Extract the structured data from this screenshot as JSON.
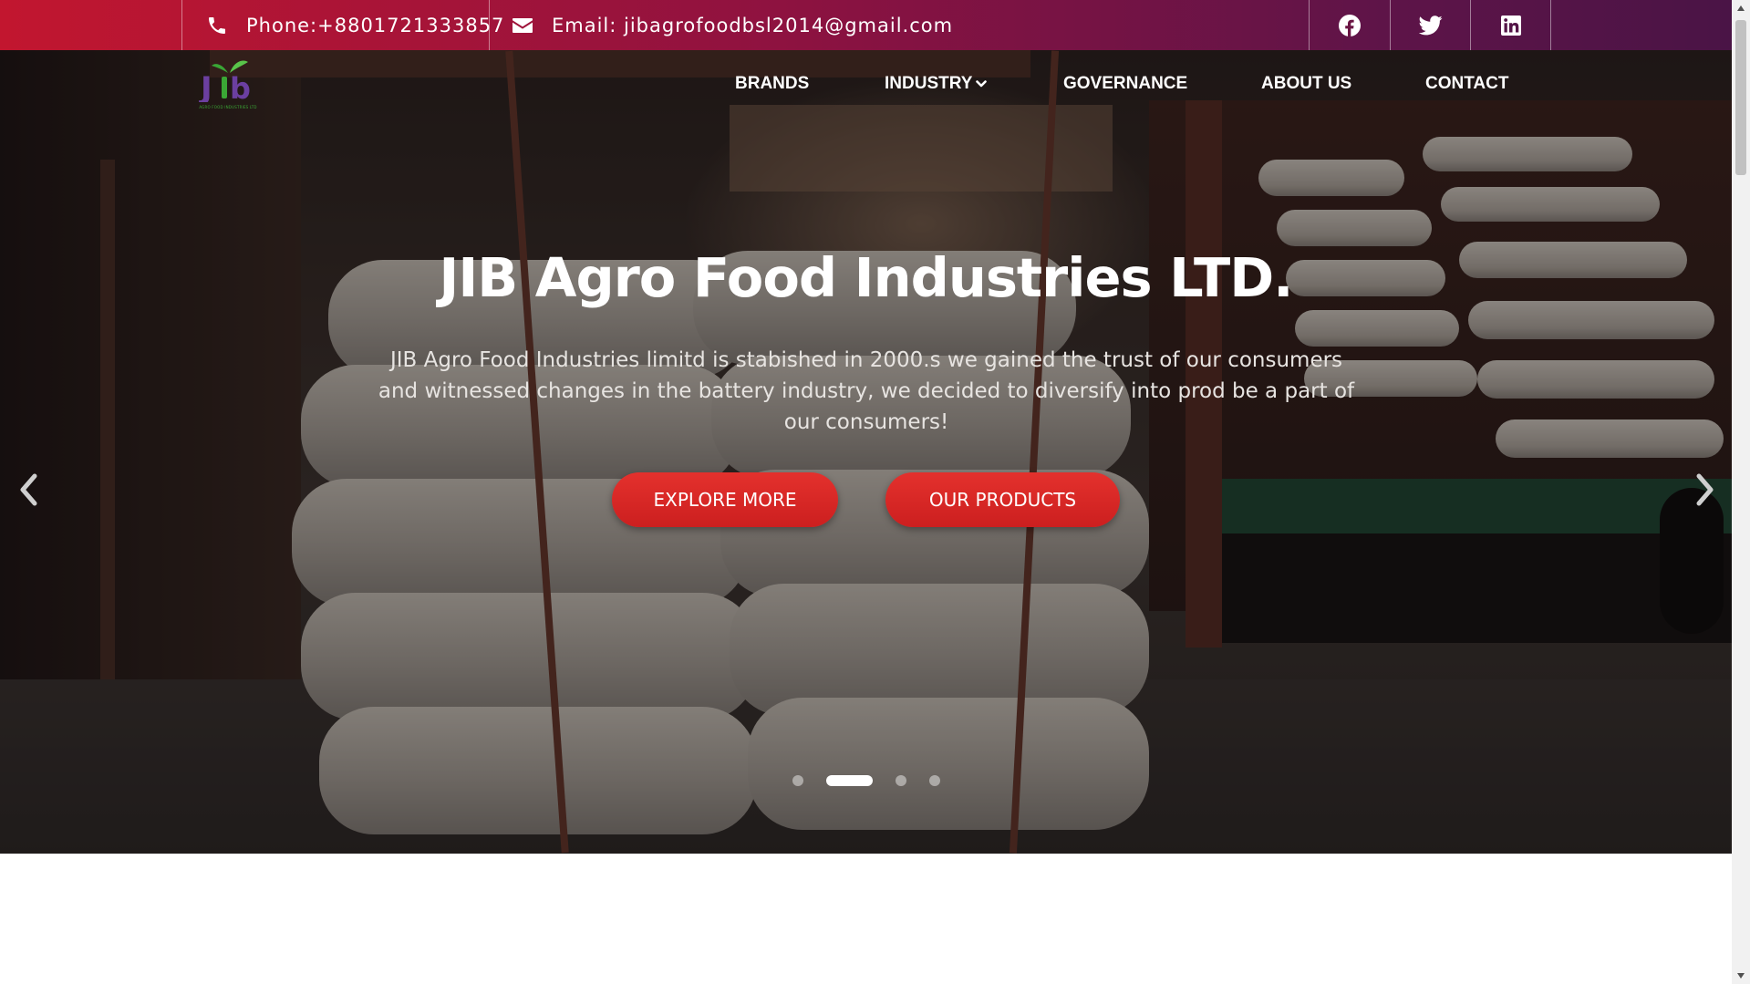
{
  "topbar": {
    "phone": "Phone:+8801721333857",
    "email": "Email: jibagrofoodbsl2014@gmail.com",
    "social": [
      {
        "icon": "facebook-icon"
      },
      {
        "icon": "twitter-icon"
      },
      {
        "icon": "linkedin-icon"
      }
    ]
  },
  "logo": {
    "text": "Jib",
    "subtext": "AGRO FOOD INDUSTRIES LTD"
  },
  "nav": {
    "items": [
      "BRANDS",
      "INDUSTRY",
      "GOVERNANCE",
      "ABOUT US",
      "CONTACT"
    ],
    "industry_icon": "chevron-down-icon"
  },
  "hero": {
    "title": "JIB Agro Food Industries LTD.",
    "text": "JIB Agro Food Industries limitd is stabished in 2000.s we gained the trust of our consumers and witnessed changes in the battery industry, we decided to diversify into prod be a part of our consumers!",
    "buttons": [
      "EXPLORE MORE",
      "OUR PRODUCTS"
    ],
    "slides_total": 4,
    "active_slide": 2
  },
  "colors": {
    "topbar_start": "#c2162f",
    "topbar_end": "#4a1446",
    "button": "#d82626",
    "logo_green": "#3aa635",
    "logo_purple": "#6b3fa0"
  }
}
